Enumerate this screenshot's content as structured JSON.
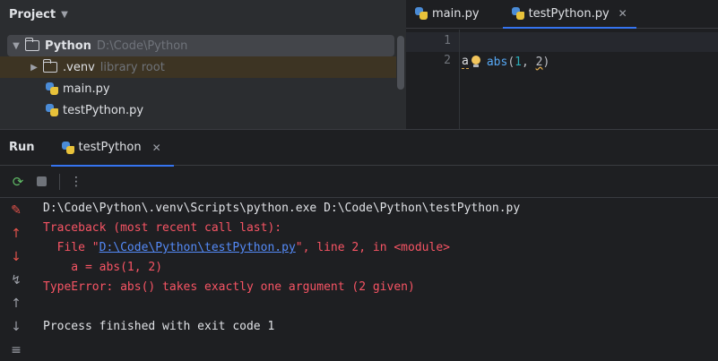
{
  "project": {
    "title": "Project",
    "root_name": "Python",
    "root_path": "D:\\Code\\Python",
    "venv_name": ".venv",
    "venv_note": "library root",
    "files": [
      "main.py",
      "testPython.py"
    ]
  },
  "editor": {
    "tabs": [
      {
        "label": "main.py",
        "active": false
      },
      {
        "label": "testPython.py",
        "active": true
      }
    ],
    "line_numbers": [
      "1",
      "2"
    ],
    "code": {
      "var": "a",
      "fn": "abs",
      "open": "(",
      "n1": "1",
      "comma": ", ",
      "n2": "2",
      "close": ")"
    }
  },
  "run": {
    "title": "Run",
    "tab_label": "testPython",
    "console": {
      "cmd": "D:\\Code\\Python\\.venv\\Scripts\\python.exe D:\\Code\\Python\\testPython.py",
      "traceback": "Traceback (most recent call last):",
      "file_prefix": "  File \"",
      "file_link": "D:\\Code\\Python\\testPython.py",
      "file_suffix": "\", line 2, in <module>",
      "code_line": "    a = abs(1, 2)",
      "error": "TypeError: abs() takes exactly one argument (2 given)",
      "exit": "Process finished with exit code 1"
    }
  },
  "icons": {
    "chevron": "chevron-down-icon",
    "folder": "folder-icon",
    "python_file": "python-file-icon",
    "rerun": "rerun-icon",
    "stop": "stop-icon",
    "more": "more-vertical-icon"
  },
  "colors": {
    "accent": "#3574f0",
    "error": "#f75464",
    "link": "#548af7"
  }
}
